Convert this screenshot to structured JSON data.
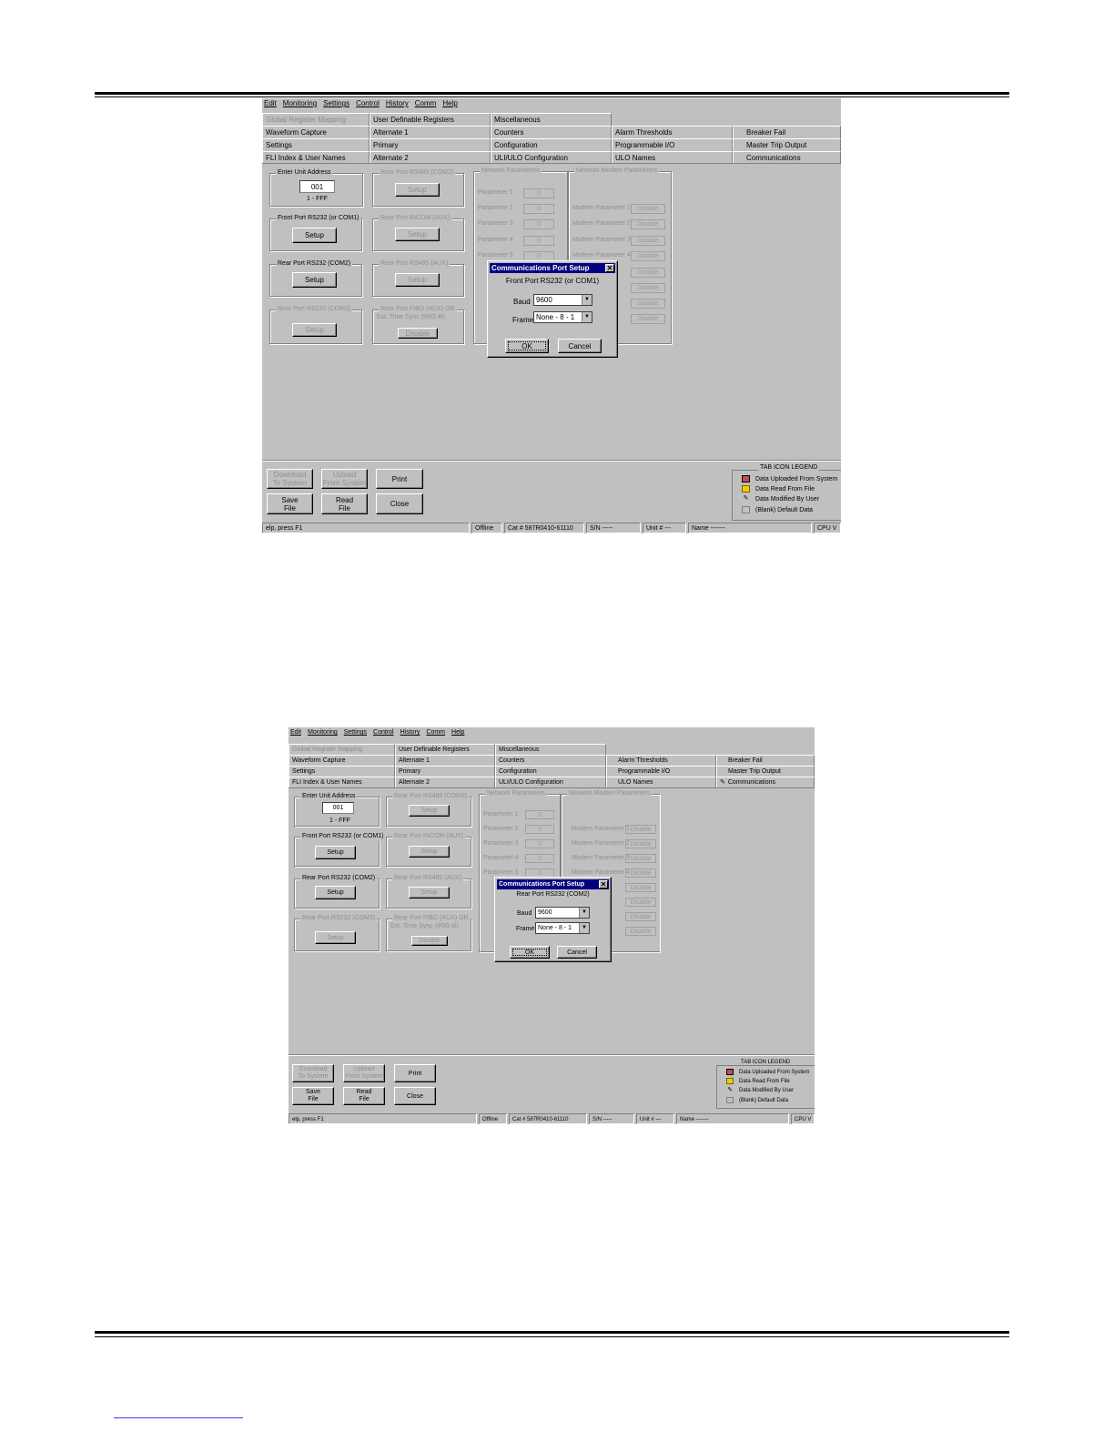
{
  "menu": [
    "Edit",
    "Monitoring",
    "Settings",
    "Control",
    "History",
    "Comm",
    "Help"
  ],
  "tabs": {
    "row1": [
      "Global Register Mapping",
      "User Definable Registers",
      "Miscellaneous"
    ],
    "row2": [
      "Waveform Capture",
      "Alternate 1",
      "Counters",
      "Alarm Thresholds",
      "Breaker Fail"
    ],
    "row3": [
      "Settings",
      "Primary",
      "Configuration",
      "Programmable I/O",
      "Master Trip Output"
    ],
    "row4": [
      "FLI Index & User Names",
      "Alternate 2",
      "ULI/ULO Configuration",
      "ULO Names",
      "Communications"
    ]
  },
  "panel": {
    "unit_address_title": "Enter Unit Address",
    "unit_address_value": "001",
    "unit_address_range": "1 - FFF",
    "front_port_title": "Front Port RS232 (or COM1)",
    "rear_port_com2_title": "Rear Port RS232 (COM2)",
    "rear_port_com3_title": "Rear Port RS232 (COM3)",
    "rear_port_rs485_title": "Rear Port RS485 (COM3)",
    "rear_port_incom_title": "Rear Port INCOM (AUX)",
    "rear_port_rs485_aux_title": "Rear Port RS485 (AUX)",
    "rear_port_fibo_title_1": "Rear Port FIBO (AUX) OR",
    "rear_port_fibo_title_2": "Ext. Time Sync (IRIG-B)",
    "setup_label": "Setup",
    "disable_label": "Disable",
    "network_params_title": "Network Parameters",
    "network_modem_title": "Network Modem Parameters",
    "params": [
      "Parameter 1",
      "Parameter 2",
      "Parameter 3",
      "Parameter 4",
      "Parameter 5"
    ],
    "param_value": "0",
    "modem_params": [
      "Modem Parameter 1",
      "Modem Parameter 2",
      "Modem Parameter 3",
      "Modem Parameter 4"
    ]
  },
  "dialog": {
    "title": "Communications Port Setup",
    "baud_label": "Baud",
    "frame_label": "Frame",
    "baud_value": "9600",
    "frame_value": "None - 8 - 1",
    "ok_label": "OK",
    "cancel_label": "Cancel",
    "subtitle_1": "Front Port RS232 (or COM1)",
    "subtitle_2": "Rear Port RS232 (COM2)"
  },
  "bottom": {
    "download_1": "Download",
    "download_2": "To System",
    "upload_1": "Upload",
    "upload_2": "From System",
    "print": "Print",
    "save_1": "Save",
    "save_2": "File",
    "read_1": "Read",
    "read_2": "File",
    "close": "Close"
  },
  "legend": {
    "title": "TAB ICON LEGEND",
    "items": [
      "Data Uploaded From System",
      "Data Read From File",
      "Data Modified By User",
      "(Blank) Default Data"
    ]
  },
  "status": {
    "help": "elp, press F1",
    "offline": "Offline",
    "cat": "Cat #  587R0410-61110",
    "sn": "S/N   -----",
    "unit": "Unit #   ---",
    "name": "Name   -------",
    "cpu": "CPU  V"
  }
}
